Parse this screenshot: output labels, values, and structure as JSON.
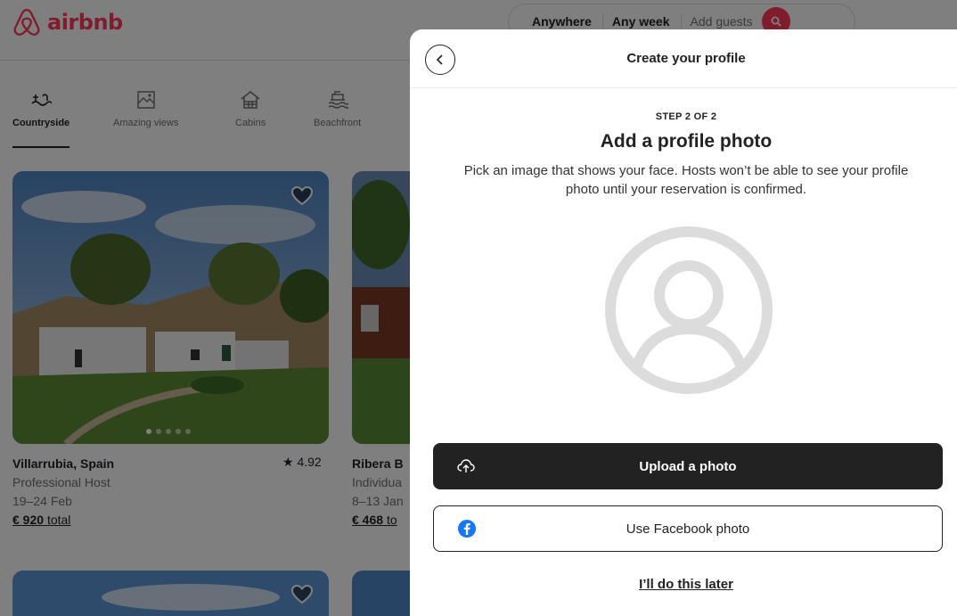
{
  "header": {
    "logo_text": "airbnb",
    "search": {
      "anywhere": "Anywhere",
      "any_week": "Any week",
      "guests": "Add guests"
    }
  },
  "categories": [
    {
      "label": "Countryside",
      "icon": "countryside-icon",
      "active": true
    },
    {
      "label": "Amazing views",
      "icon": "amazing-views-icon",
      "active": false
    },
    {
      "label": "Cabins",
      "icon": "cabins-icon",
      "active": false
    },
    {
      "label": "Beachfront",
      "icon": "beachfront-icon",
      "active": false
    }
  ],
  "listings": [
    {
      "title": "Villarrubia, Spain",
      "host": "Professional Host",
      "dates": "19–24 Feb",
      "price": "€ 920",
      "price_suffix": "total",
      "rating": "★ 4.92"
    },
    {
      "title": "Ribera B",
      "host": "Individua",
      "dates": "8–13 Jan",
      "price": "€ 468",
      "price_suffix": "to"
    }
  ],
  "modal": {
    "title": "Create your profile",
    "step": "STEP 2 OF 2",
    "heading": "Add a profile photo",
    "description": "Pick an image that shows your face. Hosts won’t be able to see your profile photo until your reservation is confirmed.",
    "upload_label": "Upload a photo",
    "facebook_label": "Use Facebook photo",
    "later_label": "I’ll do this later"
  },
  "colors": {
    "brand": "#ff385c",
    "facebook": "#1877f2",
    "dark_button": "#222222"
  }
}
